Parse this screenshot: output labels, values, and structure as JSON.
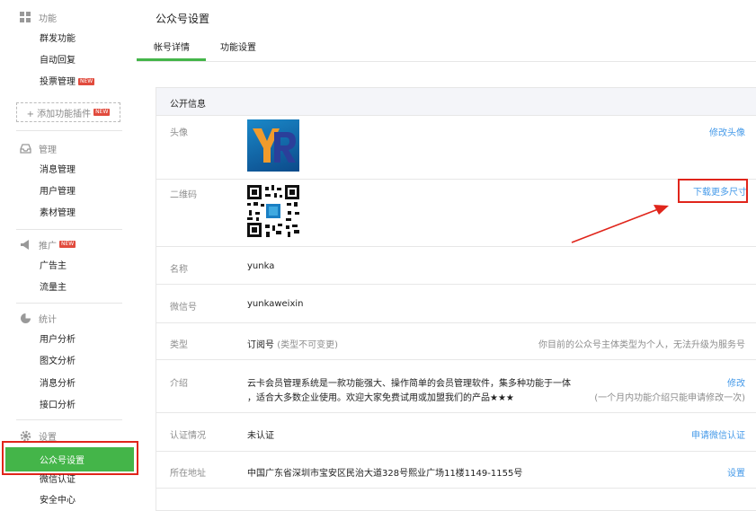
{
  "sidebar": {
    "groups": [
      {
        "label": "功能",
        "icon": "grid-icon",
        "items": [
          "群发功能",
          "自动回复",
          "投票管理"
        ]
      },
      {
        "label": "管理",
        "icon": "inbox-icon",
        "items": [
          "消息管理",
          "用户管理",
          "素材管理"
        ]
      },
      {
        "label": "推广",
        "icon": "megaphone-icon",
        "items": [
          "广告主",
          "流量主"
        ]
      },
      {
        "label": "统计",
        "icon": "pie-chart-icon",
        "items": [
          "用户分析",
          "图文分析",
          "消息分析",
          "接口分析"
        ]
      },
      {
        "label": "设置",
        "icon": "gear-icon",
        "items": [
          "公众号设置",
          "微信认证",
          "安全中心"
        ]
      }
    ],
    "new_badge": "NEW",
    "add_plugin": "+ 添加功能插件",
    "active_item": "公众号设置"
  },
  "main": {
    "title": "公众号设置",
    "tabs": [
      "帐号详情",
      "功能设置"
    ],
    "active_tab": "帐号详情",
    "panel_title": "公开信息",
    "rows": [
      {
        "label": "头像",
        "action": "修改头像"
      },
      {
        "label": "二维码",
        "action": "下载更多尺寸"
      },
      {
        "label": "名称",
        "value": "yunka"
      },
      {
        "label": "微信号",
        "value": "yunkaweixin"
      },
      {
        "label": "类型",
        "value": "订阅号",
        "value_note": "(类型不可变更)",
        "note": "你目前的公众号主体类型为个人，无法升级为服务号"
      },
      {
        "label": "介绍",
        "value_line1": "云卡会员管理系统是一款功能强大、操作简单的会员管理软件，集多种功能于一体",
        "value_line2": "，适合大多数企业使用。欢迎大家免费试用或加盟我们的产品★★★",
        "action": "修改",
        "note": "(一个月内功能介绍只能申请修改一次)"
      },
      {
        "label": "认证情况",
        "value": "未认证",
        "action": "申请微信认证"
      },
      {
        "label": "所在地址",
        "value": "中国广东省深圳市宝安区民治大道328号熙业广场11楼1149-1155号",
        "action": "设置"
      }
    ]
  },
  "colors": {
    "accent": "#44b549",
    "link": "#459ae9",
    "highlight": "#e0251b"
  }
}
